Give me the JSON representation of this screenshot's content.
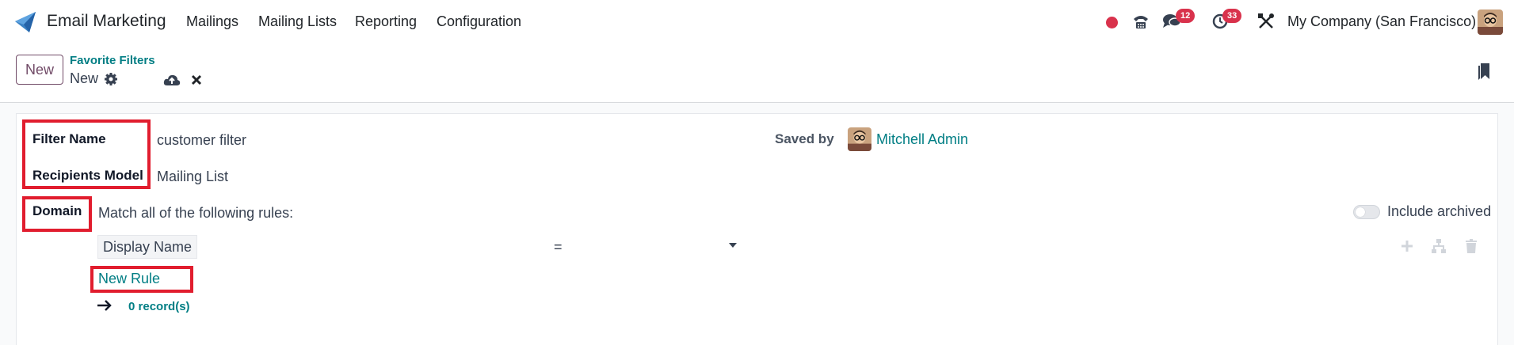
{
  "navbar": {
    "app_name": "Email Marketing",
    "menus": [
      "Mailings",
      "Mailing Lists",
      "Reporting",
      "Configuration"
    ],
    "messages_count": "12",
    "activities_count": "33",
    "company": "My Company (San Francisco)"
  },
  "controlpanel": {
    "new_label": "New",
    "breadcrumb_parent": "Favorite Filters",
    "breadcrumb_current": "New"
  },
  "form": {
    "filter_name_label": "Filter Name",
    "filter_name_value": "customer filter",
    "model_label": "Recipients Model",
    "model_value": "Mailing List",
    "saved_by_label": "Saved by",
    "saved_by_value": "Mitchell Admin",
    "domain_label": "Domain",
    "match_text": "Match all of the following rules:",
    "include_archived_label": "Include archived",
    "rule_field": "Display Name",
    "rule_operator": "=",
    "new_rule_label": "New Rule",
    "record_count": "0 record(s)"
  },
  "colors": {
    "brand": "#714b67",
    "link": "#017e84",
    "badge": "#d9324c",
    "highlight": "#e11d2e"
  }
}
